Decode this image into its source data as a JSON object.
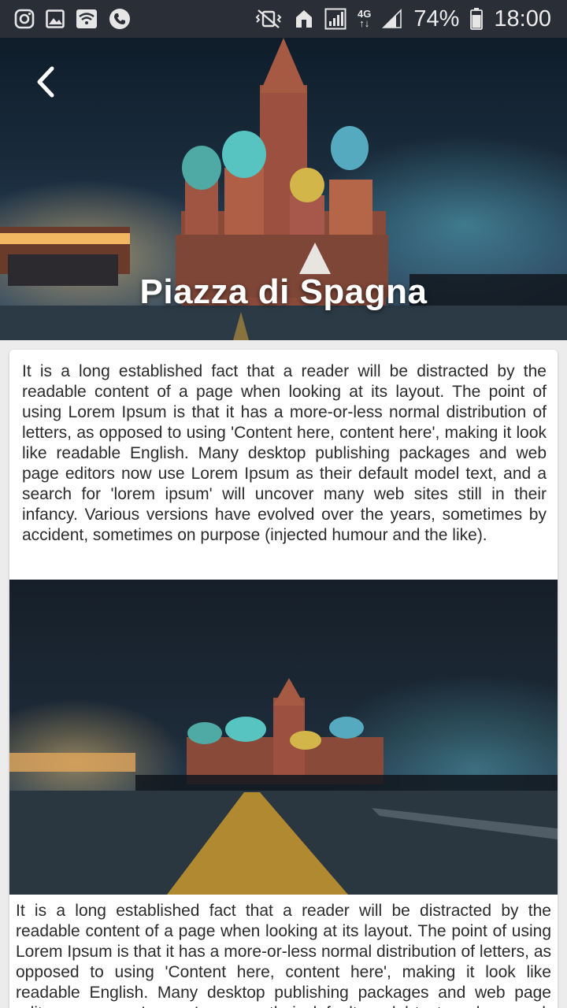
{
  "status_bar": {
    "left_icons": [
      "instagram-icon",
      "gallery-icon",
      "wifi-calling-icon",
      "phone-icon"
    ],
    "right_icons": [
      "mute-vibrate-icon",
      "home-icon",
      "signal-icon",
      "4g-icon",
      "signal-bars-icon",
      "battery-icon"
    ],
    "network_label_top": "4G",
    "network_label_bottom": "↑↓",
    "battery_percent": "74%",
    "time": "18:00"
  },
  "hero": {
    "title": "Piazza di Spagna",
    "back_icon": "chevron-left-icon"
  },
  "article": {
    "paragraph_1": "It is a long established fact that a reader will be distracted by the readable content of a page when looking at its layout. The point of using Lorem Ipsum is that it has a more-or-less normal distribution of letters, as opposed to using 'Content here, content here', making it look like readable English. Many desktop publishing packages and web page editors now use Lorem Ipsum as their default model text, and a search for 'lorem ipsum' will uncover many web sites still in their infancy. Various versions have evolved over the years, sometimes by accident, sometimes on purpose (injected humour and the like).",
    "paragraph_2": "It is a long established fact that a reader will be distracted by the readable content of a page when looking at its layout. The point of using Lorem Ipsum is that it has a more-or-less normal distribution of letters, as opposed to using 'Content here, content here', making it look like readable English. Many desktop publishing packages and web page editors now use Lorem Ipsum as their default model text, and a search for 'lorem ipsum' will uncover many web sites still in their infancy."
  },
  "colors": {
    "status_bar_bg": "#2a2e36",
    "page_bg": "#ececec",
    "card_bg": "#ffffff",
    "body_text": "#2b2b2b",
    "title_text": "#ffffff"
  }
}
